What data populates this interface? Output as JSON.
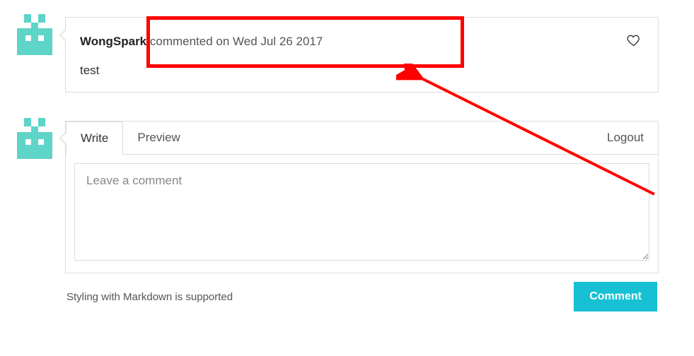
{
  "comment": {
    "author": "WongSpark",
    "meta_prefix": " commented on ",
    "date": "Wed Jul 26 2017",
    "body": "test"
  },
  "editor": {
    "tabs": {
      "write": "Write",
      "preview": "Preview"
    },
    "logout": "Logout",
    "placeholder": "Leave a comment",
    "value": ""
  },
  "footer": {
    "hint": "Styling with Markdown is supported",
    "submit": "Comment"
  },
  "colors": {
    "accent": "#17c1d3",
    "avatar": "#5fd4c8",
    "annotation": "#ff0000"
  }
}
